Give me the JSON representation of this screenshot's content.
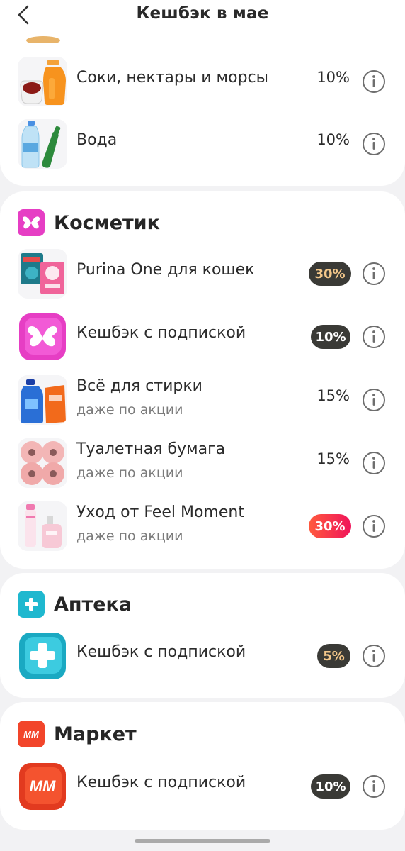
{
  "header": {
    "title": "Кешбэк в мае",
    "back_icon": "chevron-left-icon"
  },
  "top_items": [
    {
      "name": "Соки, нектары и морсы",
      "percent": "10%",
      "thumb": "juice-thumb"
    },
    {
      "name": "Вода",
      "percent": "10%",
      "thumb": "water-thumb"
    }
  ],
  "cosmetic": {
    "title": "Косметик",
    "icon_color": "#e63ec4",
    "items": [
      {
        "name": "Purina One для кошек",
        "percent": "30%",
        "badge": "dark"
      },
      {
        "name": "Кешбэк с подпиской",
        "percent": "10%",
        "badge": "dark"
      },
      {
        "name": "Всё для стирки",
        "subtitle": "даже по акции",
        "percent": "15%"
      },
      {
        "name": "Туалетная бумага",
        "subtitle": "даже по акции",
        "percent": "15%"
      },
      {
        "name": "Уход от Feel Moment",
        "subtitle": "даже по акции",
        "percent": "30%",
        "badge": "red"
      }
    ]
  },
  "pharmacy": {
    "title": "Аптека",
    "icon_color": "#1fb8cf",
    "items": [
      {
        "name": "Кешбэк с подпиской",
        "percent": "5%",
        "badge": "dark"
      }
    ]
  },
  "market": {
    "title": "Маркет",
    "icon_color": "#f2452a",
    "icon_text": "ММ",
    "items": [
      {
        "name": "Кешбэк с подпиской",
        "percent": "10%",
        "badge": "dark"
      }
    ]
  },
  "colors": {
    "badge_dark_bg": "#3a3a36",
    "badge_gold_text": "#f3c78a",
    "badge_white_text": "#ffffff",
    "info_icon": "#6e6e6e"
  }
}
